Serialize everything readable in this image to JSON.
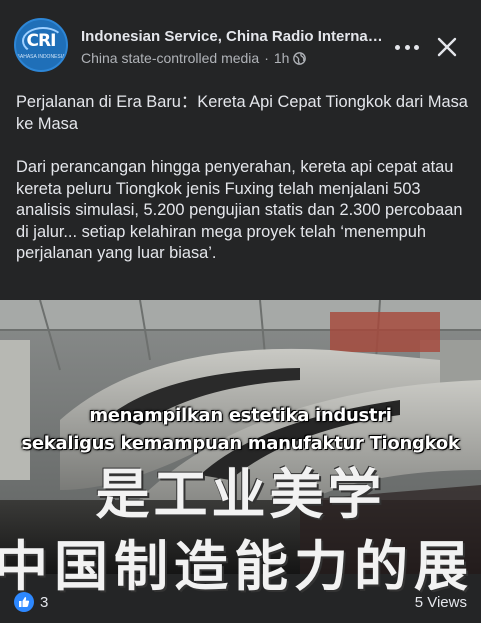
{
  "post": {
    "page_name": "Indonesian Service, China Radio Interna…",
    "label": "China state-controlled media",
    "separator": "·",
    "time": "1h",
    "avatar_logo": "CRI",
    "avatar_sub": "BAHASA INDONESIA",
    "title_line": "Perjalanan di Era Baru：Kereta Api Cepat Tiongkok dari Masa ke Masa",
    "body": "Dari perancangan hingga penyerahan, kereta api cepat atau kereta peluru Tiongkok jenis Fuxing telah menjalani 503 analisis simulasi, 5.200 pengujian statis dan 2.300 percobaan di jalur... setiap kelahiran mega proyek telah ‘menempuh perjalanan yang luar biasa’."
  },
  "video": {
    "caption_line1": "menampilkan estetika industri",
    "caption_line2": "sekaligus kemampuan manufaktur Tiongkok",
    "zh_line1": "是工业美学",
    "zh_line2": "中国制造能力的展"
  },
  "footer": {
    "like_count": "3",
    "views": "5 Views"
  },
  "icons": {
    "globe": "globe-icon",
    "more": "more-options-icon",
    "close": "close-icon",
    "like": "like-icon"
  },
  "colors": {
    "background": "#242526",
    "text": "#e4e6eb",
    "secondary": "#b0b3b8",
    "like_blue": "#2d88ff"
  }
}
